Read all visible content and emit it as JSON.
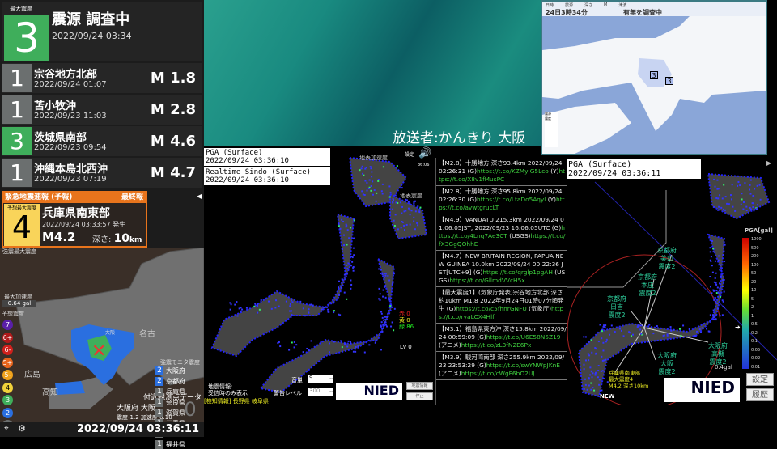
{
  "left": {
    "latest": {
      "max_label": "最大震度",
      "intensity": "3",
      "source": "震源 調査中",
      "time": "2022/09/24 03:34"
    },
    "history": [
      {
        "intensity": "1",
        "area": "宗谷地方北部",
        "time": "2022/09/24 01:07",
        "mag": "M 1.8"
      },
      {
        "intensity": "1",
        "area": "苫小牧沖",
        "time": "2022/09/23 11:03",
        "mag": "M 2.8"
      },
      {
        "intensity": "3",
        "area": "茨城県南部",
        "time": "2022/09/23 09:54",
        "mag": "M 4.6"
      },
      {
        "intensity": "1",
        "area": "沖縄本島北西沖",
        "time": "2022/09/23 07:19",
        "mag": "M 4.7"
      }
    ],
    "eew": {
      "title": "緊急地震速報 (予報)",
      "final": "最終報",
      "int_label": "予想最大震度",
      "intensity": "4",
      "area": "兵庫県南東部",
      "time": "2022/09/24 03:33:57 発生",
      "mag": "M4.2",
      "depth_label": "深さ:",
      "depth": "10",
      "depth_unit": "km"
    },
    "monitor_max_label": "強震最大震度",
    "max_acc_label": "最大加速度",
    "max_acc": "0.64 gal",
    "forecast_label": "予想震度",
    "scale": [
      "7",
      "6+",
      "6-",
      "5+",
      "5-",
      "4",
      "3",
      "2",
      "1"
    ],
    "monitor_label": "強震モニタ震度",
    "prefs": [
      {
        "n": "2",
        "name": "大阪府"
      },
      {
        "n": "2",
        "name": "京都府"
      },
      {
        "n": "1",
        "name": "兵庫県"
      },
      {
        "n": "1",
        "name": "奈良県"
      },
      {
        "n": "1",
        "name": "滋賀県"
      },
      {
        "n": "1",
        "name": "三重県"
      },
      {
        "n": "1",
        "name": "和歌山県"
      },
      {
        "n": "1",
        "name": "福井県"
      }
    ],
    "map_labels": {
      "hiroshima": "広島",
      "kochi": "高知",
      "nagoya": "名古",
      "osaka": "大阪"
    },
    "nearby_label": "付近観測点データ",
    "nearby_station": "大阪府 大阪",
    "nearby_values": "震度-1.2 加速度 0.10",
    "nearby_int": "0",
    "clock": "2022/09/24 03:36:11"
  },
  "broadcaster": "放送者:かんきり 大阪",
  "kansai": {
    "head_labels": [
      "日時",
      "震源",
      "深さ",
      "M",
      "津波"
    ],
    "time": "24日3時34分",
    "tsunami": "有無を調査中",
    "markers": [
      "3",
      "3"
    ],
    "legend": [
      "震源",
      "震度"
    ]
  },
  "pga1": {
    "pga_label": "PGA (Surface)",
    "pga_time": "2022/09/24 03:36:10",
    "sindo_label": "Realtime Sindo (Surface)",
    "sindo_time": "2022/09/24 03:36:10",
    "settings": "設定",
    "clock": "36:06",
    "acc_label": "地表加速度",
    "sindo_map_label": "地表震度",
    "red": "赤 0",
    "yellow": "黄 0",
    "green": "緑 86",
    "lv": "Lv 0",
    "vol_label": "音量",
    "vol": "9",
    "warn_label": "警告レベル",
    "warn": "300",
    "eq_info_btn": "地震情報",
    "stop_btn": "停止",
    "notice1": "地震情報:",
    "notice2": "受信時のみ表示",
    "detect": "[検知情報] 長野県 岐阜県",
    "logo": "NIED"
  },
  "tweets": [
    {
      "t": "【M2.8】十勝地方 深さ93.4km 2022/09/24 02:26:31 (G)",
      "l1": "https://t.co/KZMyIG5Lco",
      "t2": " (Y)",
      "l2": "https://t.co/X8v1fMusPC"
    },
    {
      "t": "【M2.8】十勝地方 深さ95.8km 2022/09/24 02:26:30 (G)",
      "l1": "https://t.co/LtaDo5Aqyl",
      "t2": " (Y)",
      "l2": "https://t.co/avwtgrucLT"
    },
    {
      "t": "【M4.9】VANUATU 215.3km 2022/09/24 01:06:05JST, 2022/09/23 16:06:05UTC (G)",
      "l1": "https://t.co/4Lnq7Ae3CT",
      "t2": " (USGS)",
      "l2": "https://t.co/fX3GgQOhhE"
    },
    {
      "t": "【M4.7】NEW BRITAIN REGION, PAPUA NEW GUINEA 10.0km 2022/09/24 00:22:36 JST[UTC+9] (G)",
      "l1": "https://t.co/qrglp1pgAH",
      "t2": " (USGS)",
      "l2": "https://t.co/GllmdVVcH5x"
    },
    {
      "t": "【最大震度1】(気象庁発表)宗谷地方北部 深さ約10km M1.8 2022年9月24日01時07分頃発生 (G)",
      "l1": "https://t.co/c5fhnrGNFU",
      "t2": " (気象庁)",
      "l2": "https://t.co/ryaLOX4Hlf"
    },
    {
      "t": "【M3.1】福島県東方沖 深さ15.8km 2022/09/24 00:59:09 (G)",
      "l1": "https://t.co/U6E58N5Z19",
      "t2": " (アニメ)",
      "l2": "https://t.co/zL3fN2E6Px"
    },
    {
      "t": "【M3.9】駿河湾南部 深さ255.9km 2022/09/23 23:53:29 (G)",
      "l1": "https://t.co/swYNWpJKnE",
      "t2": " (アニメ)",
      "l2": "https://t.co/cWgF6bO2UJ"
    }
  ],
  "kmon": {
    "pga_label": "PGA (Surface)",
    "time": "2022/09/24 03:36:11",
    "scale_title": "PGA[gal]",
    "scale_ticks": [
      "1000",
      "500",
      "200",
      "100",
      "50",
      "20",
      "10",
      "5",
      "2",
      "1",
      "0.5",
      "0.2",
      "0.1",
      "0.05",
      "0.02",
      "0.01"
    ],
    "current": "0.4gal",
    "stations": [
      {
        "pref": "京都府",
        "name": "美山",
        "int": "震度2"
      },
      {
        "pref": "京都府",
        "name": "本庄",
        "int": "震度2"
      },
      {
        "pref": "京都府",
        "name": "日吉",
        "int": "震度2"
      },
      {
        "pref": "大阪府",
        "name": "高槻",
        "int": "震度2"
      },
      {
        "pref": "大阪府",
        "name": "大阪",
        "int": "震度2"
      }
    ],
    "epicenter": {
      "area": "兵庫県南東部",
      "max": "最大震度4",
      "mag": "M4.2 深さ10km"
    },
    "new_label": "NEW",
    "settings_btn": "設定",
    "history_btn": "履歴",
    "logo": "NIED"
  },
  "colors": {
    "green": "#3fae5b",
    "gray": "#6b6f6f",
    "orange": "#e8741c",
    "yellow": "#f9d45a",
    "blue": "#2a6fe0"
  }
}
